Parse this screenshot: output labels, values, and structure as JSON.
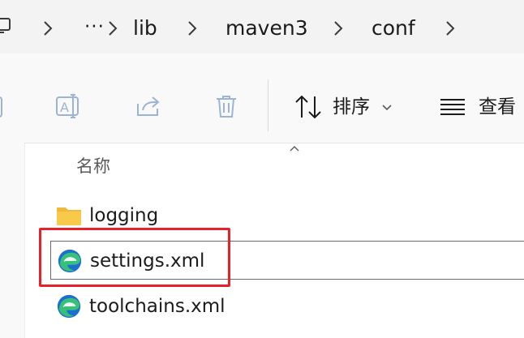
{
  "address_bar": {
    "breadcrumbs": [
      "lib",
      "maven3",
      "conf"
    ],
    "overflow_label": "···",
    "icons": [
      "computer-icon",
      "chevron-right-icon"
    ]
  },
  "command_bar": {
    "actions": [
      {
        "name": "rename",
        "icon": "rename-icon"
      },
      {
        "name": "share",
        "icon": "share-icon"
      },
      {
        "name": "delete",
        "icon": "trash-icon"
      }
    ],
    "sort_label": "排序",
    "view_label": "查看"
  },
  "file_list": {
    "column_header": "名称",
    "items": [
      {
        "name": "logging",
        "type": "folder",
        "icon": "folder-icon",
        "selected": false
      },
      {
        "name": "settings.xml",
        "type": "xml",
        "icon": "edge-file-icon",
        "selected": true
      },
      {
        "name": "toolchains.xml",
        "type": "xml",
        "icon": "edge-file-icon",
        "selected": false
      }
    ]
  },
  "colors": {
    "highlight_box": "#e8202a",
    "folder_yellow": "#f8c94a",
    "edge_blue": "#1b6fd0",
    "edge_green": "#36c07a"
  }
}
